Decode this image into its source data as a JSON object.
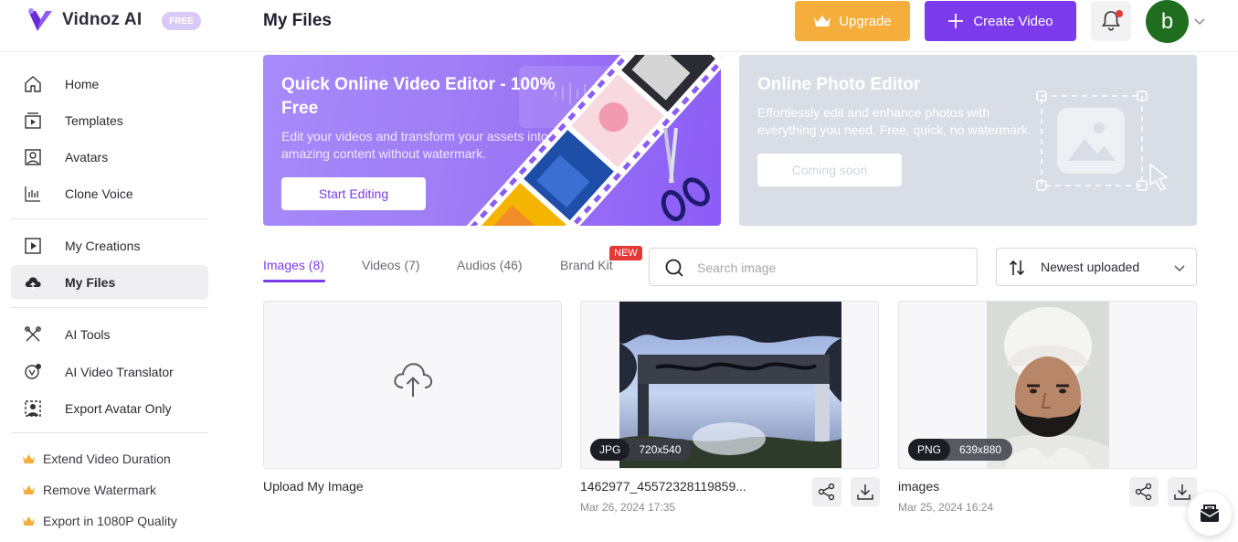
{
  "brand": {
    "name": "Vidnoz AI",
    "plan_badge": "FREE"
  },
  "header": {
    "title": "My Files",
    "upgrade_label": "Upgrade",
    "create_label": "Create Video",
    "avatar_initial": "b"
  },
  "sidebar": {
    "group1": [
      {
        "label": "Home",
        "icon": "home-icon"
      },
      {
        "label": "Templates",
        "icon": "templates-icon"
      },
      {
        "label": "Avatars",
        "icon": "avatar-icon"
      },
      {
        "label": "Clone Voice",
        "icon": "waveform-icon"
      }
    ],
    "group2": [
      {
        "label": "My Creations",
        "icon": "play-square-icon"
      },
      {
        "label": "My Files",
        "icon": "cloud-upload-icon",
        "active": true
      }
    ],
    "group3": [
      {
        "label": "AI Tools",
        "icon": "tools-icon"
      },
      {
        "label": "AI Video Translator",
        "icon": "translate-icon"
      },
      {
        "label": "Export Avatar Only",
        "icon": "export-avatar-icon"
      }
    ],
    "promos": [
      {
        "label": "Extend Video Duration"
      },
      {
        "label": "Remove Watermark"
      },
      {
        "label": "Export in 1080P Quality"
      }
    ]
  },
  "banners": {
    "video_editor": {
      "title": "Quick Online Video Editor - 100% Free",
      "subtitle": "Edit your videos and transform your assets into amazing content without watermark.",
      "button": "Start Editing"
    },
    "photo_editor": {
      "title": "Online Photo Editor",
      "subtitle": "Effortlessly edit and enhance photos with everything you need. Free, quick, no watermark.",
      "button": "Coming soon"
    }
  },
  "tabs": [
    {
      "label": "Images (8)",
      "active": true
    },
    {
      "label": "Videos (7)"
    },
    {
      "label": "Audios (46)"
    },
    {
      "label": "Brand Kit",
      "badge": "NEW"
    }
  ],
  "search": {
    "placeholder": "Search image",
    "value": ""
  },
  "sort": {
    "selected": "Newest uploaded"
  },
  "cards": {
    "upload": {
      "label": "Upload My Image"
    },
    "files": [
      {
        "name": "1462977_45572328119859...",
        "date": "Mar 26, 2024 17:35",
        "type": "JPG",
        "dimensions": "720x540"
      },
      {
        "name": "images",
        "date": "Mar 25, 2024 16:24",
        "type": "PNG",
        "dimensions": "639x880"
      }
    ]
  },
  "colors": {
    "accent": "#7c3aed",
    "upgrade": "#f5ad3c",
    "badge_new": "#e53935"
  }
}
